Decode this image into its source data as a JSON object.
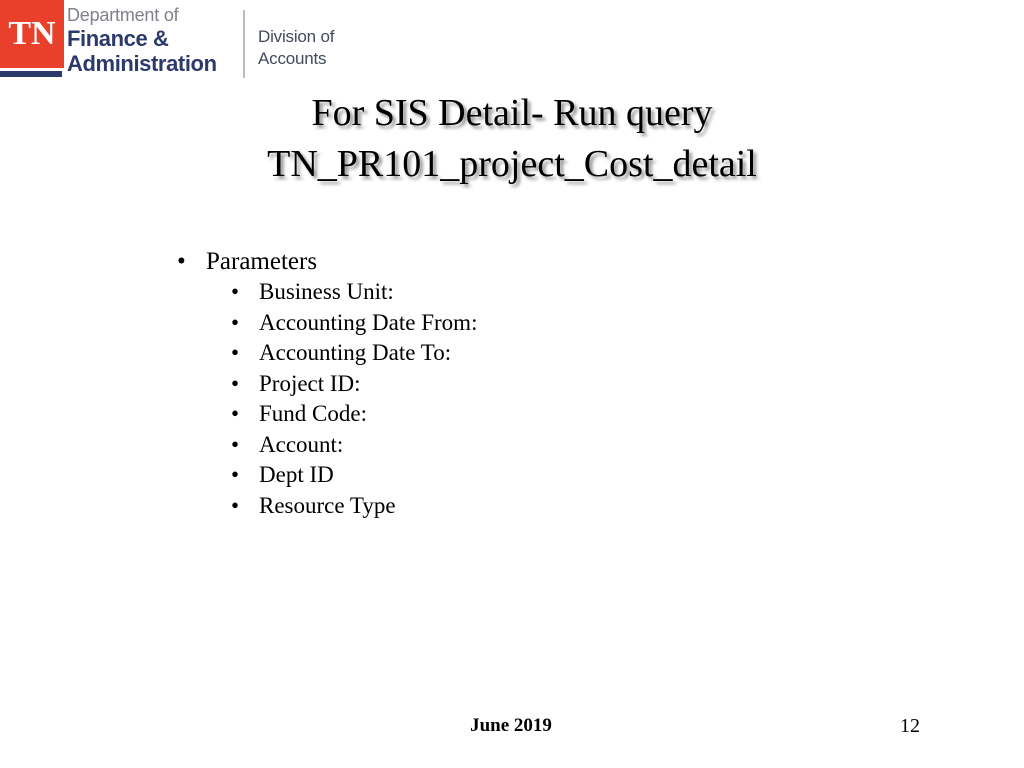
{
  "slide": {
    "background_color": "#ffffff"
  },
  "logo": {
    "mark_text": "TN",
    "mark_color": "#e8402a",
    "navy_color": "#2b3a6b",
    "gray_color": "#7e818a",
    "department_line1": "Department of",
    "department_line2": "Finance &",
    "department_line3": "Administration",
    "division_line1": "Division of",
    "division_line2": "Accounts"
  },
  "title": {
    "line1": "For SIS Detail- Run query",
    "line2": "TN_PR101_project_Cost_detail"
  },
  "content": {
    "bullet_glyph": "•",
    "level1": "Parameters",
    "level2": [
      "Business Unit:",
      "Accounting Date From:",
      "Accounting Date To:",
      "Project ID:",
      "Fund Code:",
      "Account:",
      "Dept ID",
      "Resource Type"
    ]
  },
  "footer": {
    "date": "June 2019",
    "page_number": "12"
  }
}
